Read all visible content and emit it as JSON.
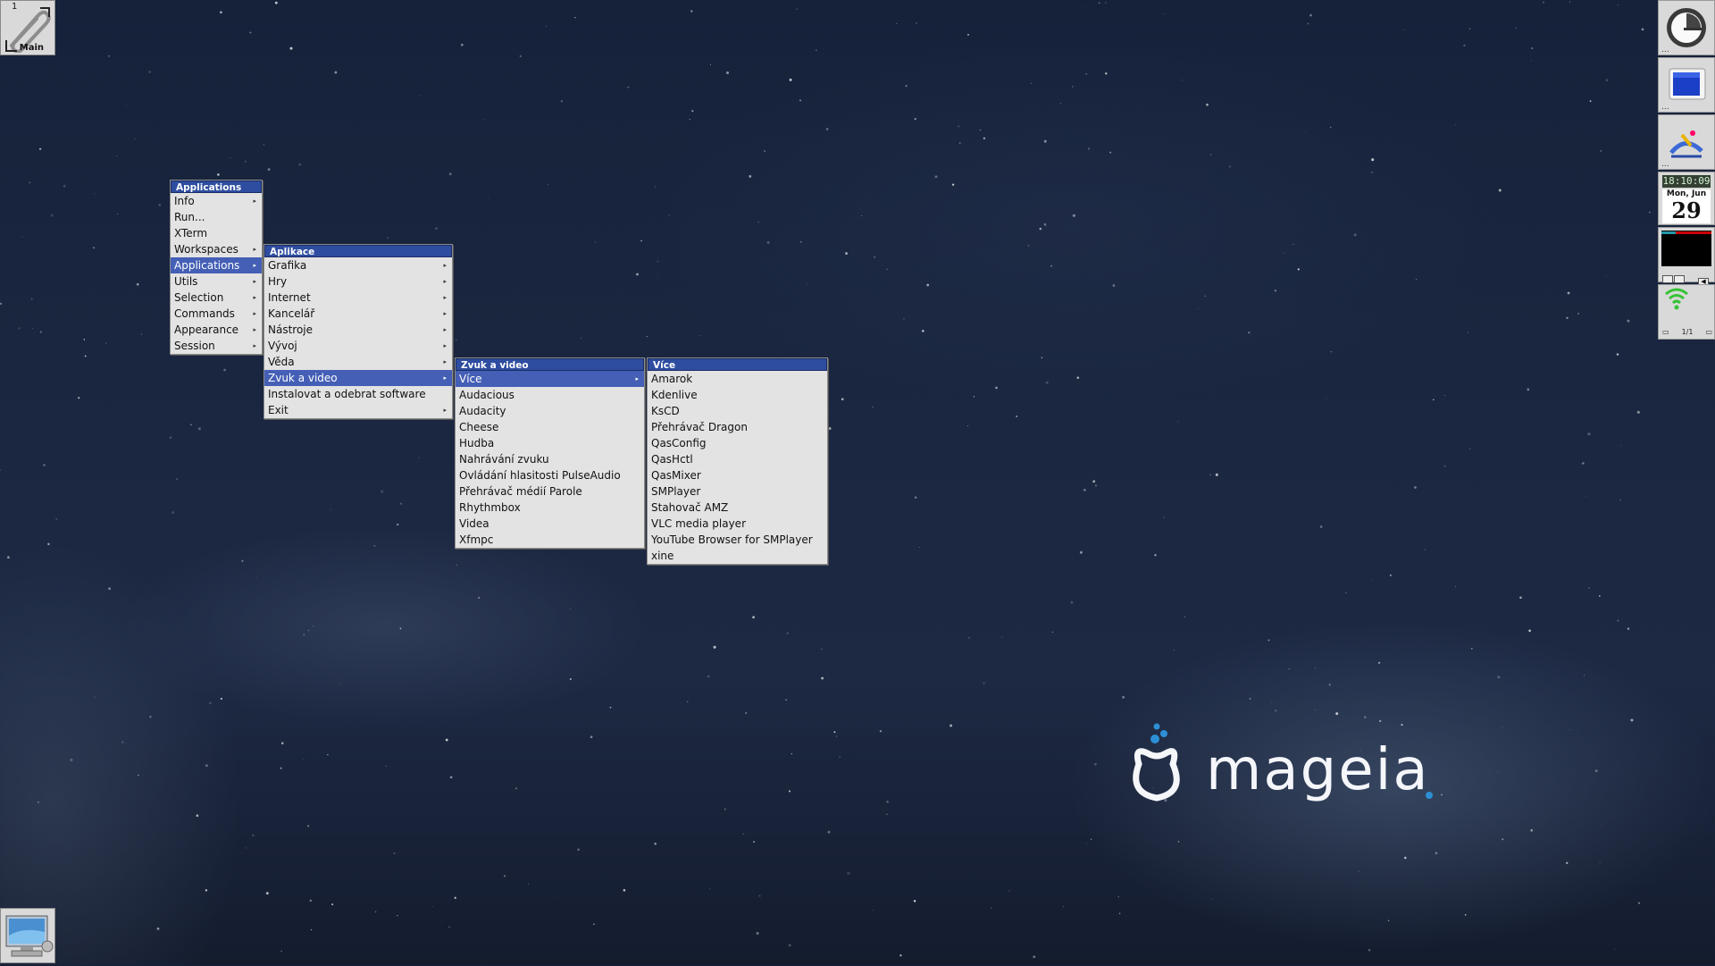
{
  "pager": {
    "workspace_number": "1",
    "workspace_name": "Main"
  },
  "dock": {
    "clock": {
      "time": "18:10:09",
      "day_of_week": "Mon, Jun",
      "day": "29"
    },
    "network": {
      "page": "1/1"
    }
  },
  "menus": {
    "root": {
      "title": "Applications",
      "items": [
        "Info",
        "Run...",
        "XTerm",
        "Workspaces",
        "Applications",
        "Utils",
        "Selection",
        "Commands",
        "Appearance",
        "Session"
      ]
    },
    "aplikace": {
      "title": "Aplikace",
      "items": [
        "Grafika",
        "Hry",
        "Internet",
        "Kancelář",
        "Nástroje",
        "Vývoj",
        "Věda",
        "Zvuk a video",
        "Instalovat a odebrat software",
        "Exit"
      ]
    },
    "zvuk": {
      "title": "Zvuk a video",
      "items": [
        "Více",
        "Audacious",
        "Audacity",
        "Cheese",
        "Hudba",
        "Nahrávání zvuku",
        "Ovládání hlasitosti PulseAudio",
        "Přehrávač médií Parole",
        "Rhythmbox",
        "Videa",
        "Xfmpc"
      ]
    },
    "vice": {
      "title": "Více",
      "items": [
        "Amarok",
        "Kdenlive",
        "KsCD",
        "Přehrávač Dragon",
        "QasConfig",
        "QasHctl",
        "QasMixer",
        "SMPlayer",
        "Stahovač AMZ",
        "VLC media player",
        "YouTube Browser for SMPlayer",
        "xine"
      ]
    }
  },
  "logo": {
    "text": "mageia"
  },
  "colors": {
    "menu_title": "#2e4da0",
    "menu_highlight": "#445fb5",
    "menu_bg": "#e3e3e3",
    "logo_blue": "#2d8fd5"
  },
  "icons": [
    "paperclip-icon",
    "computer-icon",
    "clock-icon",
    "monitor-icon",
    "draw-icon",
    "wifi-icon"
  ]
}
